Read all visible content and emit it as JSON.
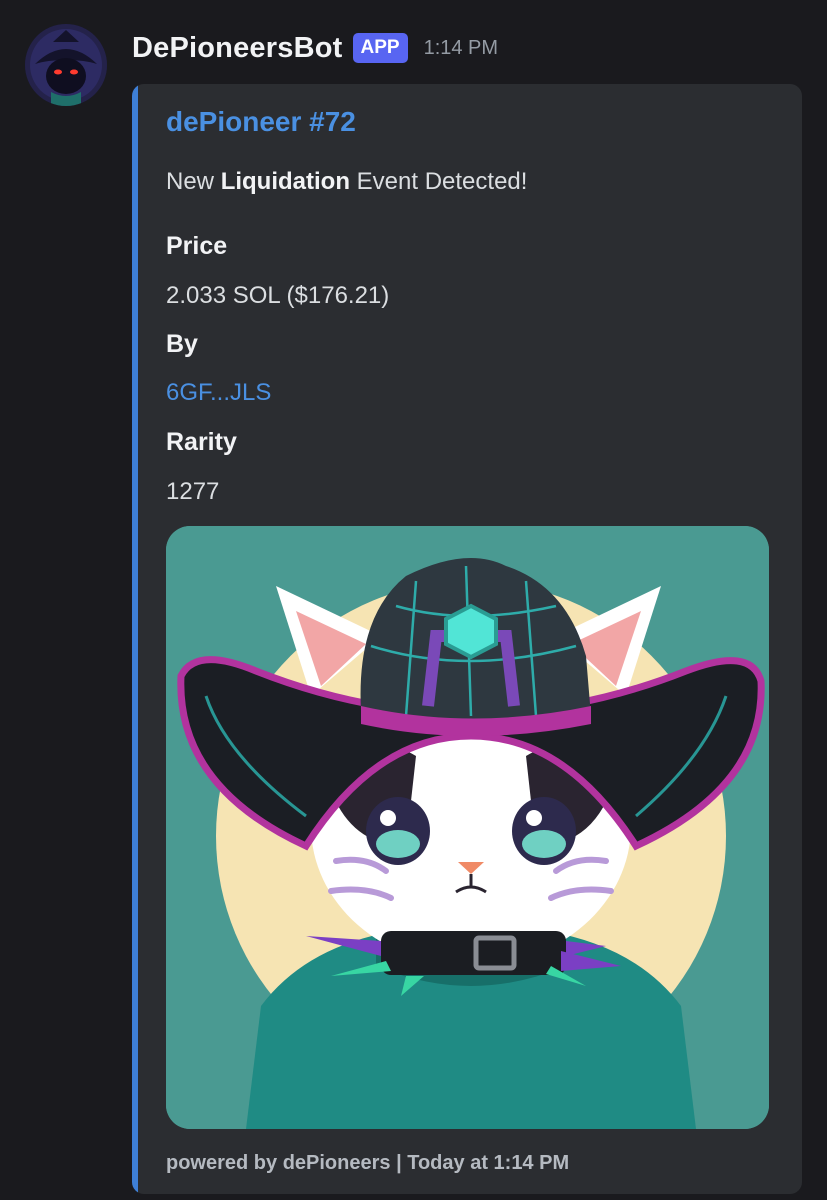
{
  "message": {
    "author": "DePioneersBot",
    "badge": "APP",
    "timestamp": "1:14 PM",
    "avatar_icon": "hooded-cat-avatar"
  },
  "embed": {
    "title": "dePioneer #72",
    "description_prefix": "New ",
    "description_bold": "Liquidation",
    "description_suffix": " Event Detected!",
    "fields": [
      {
        "name": "Price",
        "value": "2.033 SOL ($176.21)"
      },
      {
        "name": "By",
        "value": "6GF...JLS"
      },
      {
        "name": "Rarity",
        "value": "1277"
      }
    ],
    "image_icon": "cowboy-cat-nft-image",
    "footer": "powered by dePioneers | Today at 1:14 PM",
    "accent_color": "#3e7fd6"
  }
}
